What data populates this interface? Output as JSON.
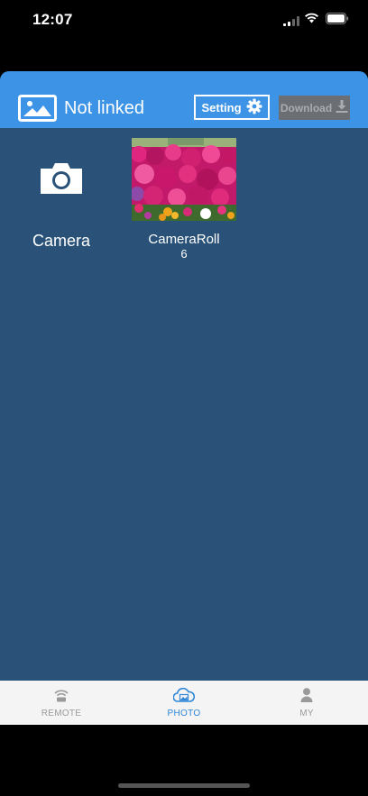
{
  "status_bar": {
    "time": "12:07"
  },
  "header": {
    "link_status": "Not linked",
    "setting_label": "Setting",
    "download_label": "Download"
  },
  "camera": {
    "label": "Camera"
  },
  "album": {
    "name": "CameraRoll",
    "count": "6"
  },
  "tabs": [
    {
      "label": "REMOTE",
      "icon": "remote-wifi-icon",
      "active": false
    },
    {
      "label": "PHOTO",
      "icon": "photo-cloud-icon",
      "active": true
    },
    {
      "label": "MY",
      "icon": "person-icon",
      "active": false
    }
  ],
  "colors": {
    "header": "#3d93e6",
    "background": "#2a5278",
    "active_tab": "#2f86d6",
    "download_disabled": "#6b6f73"
  }
}
